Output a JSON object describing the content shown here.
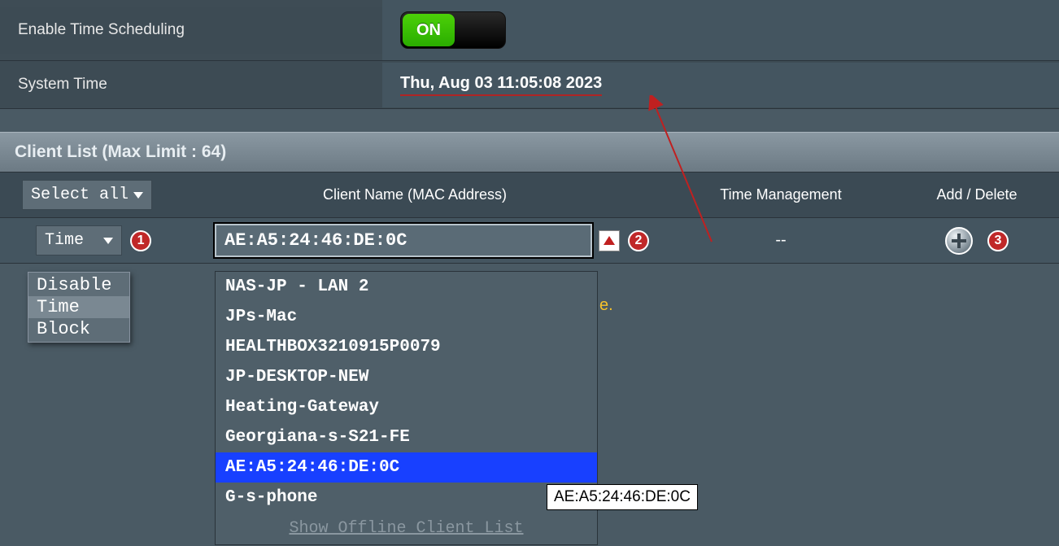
{
  "rows": {
    "enable_label": "Enable Time Scheduling",
    "toggle_label": "ON",
    "systime_label": "System Time",
    "systime_value": "Thu, Aug 03 11:05:08 2023"
  },
  "section": {
    "title": "Client List (Max Limit : 64)"
  },
  "columns": {
    "select_all": "Select all",
    "client_name": "Client Name (MAC Address)",
    "time_mgmt": "Time Management",
    "add_delete": "Add / Delete"
  },
  "datarow": {
    "time_selected": "Time",
    "mac_value": "AE:A5:24:46:DE:0C",
    "time_mgmt_value": "--"
  },
  "time_options": [
    "Disable",
    "Time",
    "Block"
  ],
  "client_options": [
    "NAS-JP - LAN 2",
    "JPs-Mac",
    "HEALTHBOX3210915P0079",
    "JP-DESKTOP-NEW",
    "Heating-Gateway",
    "Georgiana-s-S21-FE",
    "AE:A5:24:46:DE:0C",
    "G-s-phone"
  ],
  "client_selected_index": 6,
  "offline_link": "Show Offline Client List",
  "tooltip": "AE:A5:24:46:DE:0C",
  "badges": {
    "one": "1",
    "two": "2",
    "three": "3"
  },
  "fragment": "e."
}
